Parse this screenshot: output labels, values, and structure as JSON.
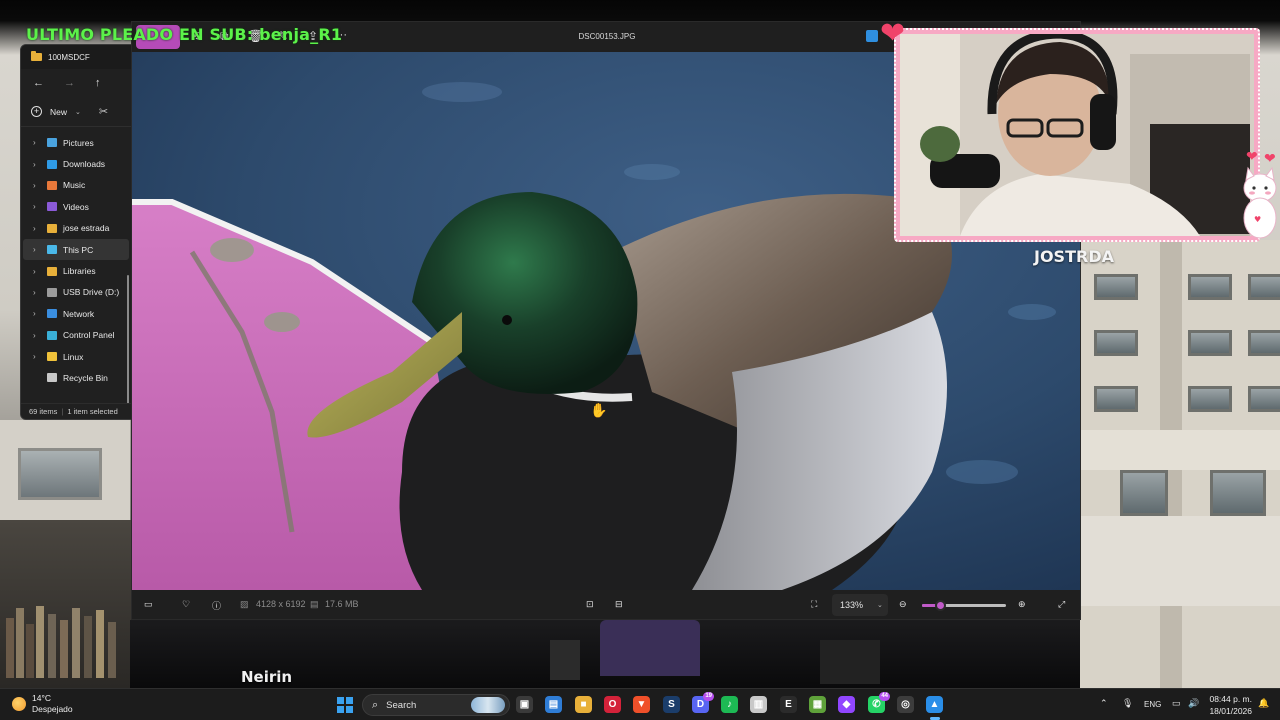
{
  "overlay": {
    "banner_text": "ULTIMO PLEADO EN SUB: benja_R1",
    "streamer_name": "JOSTRDA",
    "viewer_name": "Neirin"
  },
  "explorer": {
    "title": "100MSDCF",
    "new_label": "New",
    "nav_items": [
      {
        "label": "Pictures",
        "icon": "pictures-icon",
        "color": "#4aa3df"
      },
      {
        "label": "Downloads",
        "icon": "downloads-icon",
        "color": "#2f9be6"
      },
      {
        "label": "Music",
        "icon": "music-icon",
        "color": "#e8783a"
      },
      {
        "label": "Videos",
        "icon": "videos-icon",
        "color": "#8b5ad8"
      },
      {
        "label": "jose estrada",
        "icon": "folder-icon",
        "color": "#e8b03a"
      },
      {
        "label": "This PC",
        "icon": "computer-icon",
        "color": "#4ab8e8"
      },
      {
        "label": "Libraries",
        "icon": "folder-icon",
        "color": "#e8b03a"
      },
      {
        "label": "USB Drive (D:)",
        "icon": "usb-drive-icon",
        "color": "#9c9c9c"
      },
      {
        "label": "Network",
        "icon": "network-icon",
        "color": "#3a8ee0"
      },
      {
        "label": "Control Panel",
        "icon": "control-panel-icon",
        "color": "#3ab0d8"
      },
      {
        "label": "Linux",
        "icon": "linux-icon",
        "color": "#f0c23a"
      },
      {
        "label": "Recycle Bin",
        "icon": "recycle-bin-icon",
        "color": "#c8c8c8"
      }
    ],
    "status_items": "69 items",
    "status_selected": "1 item selected"
  },
  "viewer": {
    "filename": "DSC00153.JPG",
    "more_label": "···",
    "dimensions": "4128 x 6192",
    "file_size": "17.6 MB",
    "zoom_value": "133%",
    "zoom_fraction": 0.22
  },
  "taskbar": {
    "temperature": "14°C",
    "weather_desc": "Despejado",
    "search_label": "Search",
    "apps": [
      {
        "name": "task-view",
        "glyph": "▣",
        "color": "#3a3a3a"
      },
      {
        "name": "photos-app",
        "glyph": "▤",
        "color": "#2f7dd6"
      },
      {
        "name": "file-explorer",
        "glyph": "■",
        "color": "#e8b03a"
      },
      {
        "name": "opera",
        "glyph": "O",
        "color": "#d4223a"
      },
      {
        "name": "brave",
        "glyph": "▼",
        "color": "#f0502a"
      },
      {
        "name": "steam",
        "glyph": "S",
        "color": "#1b3d6a"
      },
      {
        "name": "discord",
        "glyph": "D",
        "color": "#5865f2",
        "badge": "19"
      },
      {
        "name": "spotify",
        "glyph": "♪",
        "color": "#1db954"
      },
      {
        "name": "app-notes",
        "glyph": "▥",
        "color": "#c8c8c8"
      },
      {
        "name": "epic-games",
        "glyph": "E",
        "color": "#2b2b2b"
      },
      {
        "name": "minecraft",
        "glyph": "▦",
        "color": "#5fa23a"
      },
      {
        "name": "twitch-obs",
        "glyph": "◆",
        "color": "#9146ff"
      },
      {
        "name": "whatsapp",
        "glyph": "✆",
        "color": "#25d366",
        "badge": "44"
      },
      {
        "name": "chrome-like",
        "glyph": "◎",
        "color": "#3c3c3c"
      },
      {
        "name": "photos-active",
        "glyph": "▲",
        "color": "#2a8ee8"
      }
    ],
    "language": "ENG",
    "time": "08:44 p. m.",
    "date": "18/01/2026"
  },
  "colors": {
    "accent": "#c05ac8",
    "banner": "#5cf24a",
    "cam_border": "#f7a9c4"
  }
}
